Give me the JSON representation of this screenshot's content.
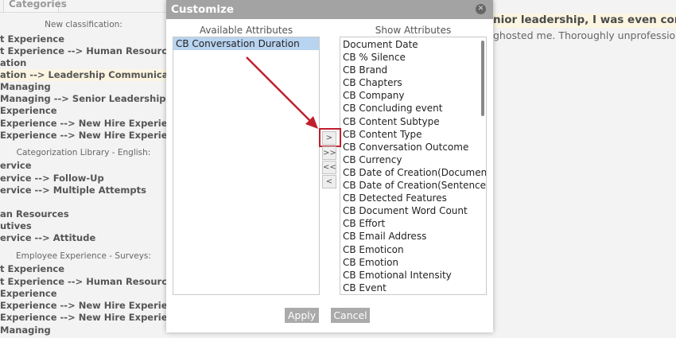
{
  "background": {
    "tab": "Categories",
    "groups": [
      {
        "header": "New classification:",
        "items": [
          "t Experience",
          "t Experience --> Human Resources Dep",
          "ation",
          "ation --> Leadership Communication",
          "Managing",
          "Managing --> Senior Leadership",
          "Experience",
          "Experience --> New Hire Experience",
          "Experience --> New Hire Experience -->"
        ]
      },
      {
        "header": "Categorization Library - English:",
        "items": [
          "ervice",
          "ervice --> Follow-Up",
          "ervice --> Multiple Attempts",
          "",
          "an Resources",
          "utives",
          "ervice --> Attitude"
        ]
      },
      {
        "header": "Employee Experience - Surveys:",
        "items": [
          "t Experience",
          "t Experience --> Human Resources Dep",
          "Experience",
          "Experience --> New Hire Experience",
          "Experience --> New Hire Experience -->",
          "Managing"
        ]
      }
    ],
    "text_line1": "nior leadership, I was even commun",
    "text_line2": "ghosted me. Thoroughly unprofessional. I wil"
  },
  "modal": {
    "title": "Customize",
    "available_label": "Available Attributes",
    "show_label": "Show Attributes",
    "available": [
      "CB Conversation Duration"
    ],
    "show": [
      "Document Date",
      "CB % Silence",
      "CB Brand",
      "CB Chapters",
      "CB Company",
      "CB Concluding event",
      "CB Content Subtype",
      "CB Content Type",
      "CB Conversation Outcome",
      "CB Currency",
      "CB Date of Creation(Document)",
      "CB Date of Creation(Sentence)",
      "CB Detected Features",
      "CB Document Word Count",
      "CB Effort",
      "CB Email Address",
      "CB Emoticon",
      "CB Emotion",
      "CB Emotional Intensity",
      "CB Event"
    ],
    "move_buttons": [
      ">",
      ">>",
      "<<",
      "<"
    ],
    "apply": "Apply",
    "cancel": "Cancel",
    "annotation_color": "#c0202e"
  }
}
